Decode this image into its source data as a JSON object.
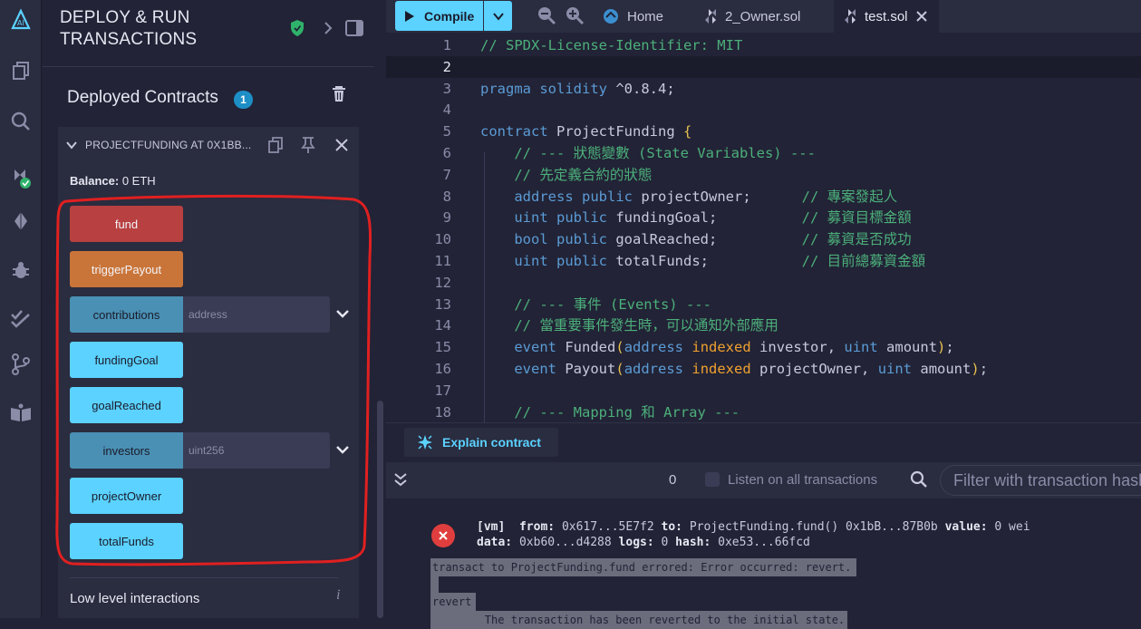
{
  "panel": {
    "title_line1": "DEPLOY & RUN",
    "title_line2": "TRANSACTIONS",
    "deployed_label": "Deployed Contracts",
    "deployed_count": "1",
    "contract_name": "PROJECTFUNDING AT 0X1BB...",
    "balance_label": "Balance:",
    "balance_value": "0 ETH",
    "functions": [
      {
        "label": "fund",
        "style": "red"
      },
      {
        "label": "triggerPayout",
        "style": "orange"
      },
      {
        "label": "contributions",
        "style": "dim",
        "placeholder": "address"
      },
      {
        "label": "fundingGoal",
        "style": "blue"
      },
      {
        "label": "goalReached",
        "style": "blue"
      },
      {
        "label": "investors",
        "style": "dim",
        "placeholder": "uint256"
      },
      {
        "label": "projectOwner",
        "style": "blue"
      },
      {
        "label": "totalFunds",
        "style": "blue"
      }
    ],
    "low_level": "Low level interactions",
    "info_glyph": "i"
  },
  "editor": {
    "compile_label": "Compile",
    "tabs": [
      {
        "label": "Home",
        "icon": "home-icon"
      },
      {
        "label": "2_Owner.sol",
        "icon": "solidity-icon"
      },
      {
        "label": "test.sol",
        "icon": "solidity-icon",
        "active": true
      }
    ],
    "lines": [
      {
        "n": "1",
        "t": "// SPDX-License-Identifier: MIT"
      },
      {
        "n": "2",
        "t": ""
      },
      {
        "n": "3",
        "t": "pragma solidity ^0.8.4;"
      },
      {
        "n": "4",
        "t": ""
      },
      {
        "n": "5",
        "t": "contract ProjectFunding {"
      },
      {
        "n": "6",
        "t": "    // --- 狀態變數 (State Variables) ---"
      },
      {
        "n": "7",
        "t": "    // 先定義合約的狀態"
      },
      {
        "n": "8",
        "t": "    address public projectOwner;      // 專案發起人"
      },
      {
        "n": "9",
        "t": "    uint public fundingGoal;          // 募資目標金額"
      },
      {
        "n": "10",
        "t": "    bool public goalReached;          // 募資是否成功"
      },
      {
        "n": "11",
        "t": "    uint public totalFunds;           // 目前總募資金額"
      },
      {
        "n": "12",
        "t": ""
      },
      {
        "n": "13",
        "t": "    // --- 事件 (Events) ---"
      },
      {
        "n": "14",
        "t": "    // 當重要事件發生時，可以通知外部應用"
      },
      {
        "n": "15",
        "t": "    event Funded(address indexed investor, uint amount);"
      },
      {
        "n": "16",
        "t": "    event Payout(address indexed projectOwner, uint amount);"
      },
      {
        "n": "17",
        "t": ""
      },
      {
        "n": "18",
        "t": "    // --- Mapping 和 Array ---"
      }
    ],
    "explain_label": "Explain contract"
  },
  "terminal": {
    "count": "0",
    "listen_label": "Listen on all transactions",
    "filter_placeholder": "Filter with transaction hash or address",
    "log_vm": "[vm]",
    "log_from_label": "from:",
    "log_from": "0x617...5E7f2",
    "log_to_label": "to:",
    "log_to": "ProjectFunding.fund() 0x1bB...87B0b",
    "log_value_label": "value:",
    "log_value": "0 wei",
    "log_data_label": "data:",
    "log_data": "0xb60...d4288",
    "log_logs_label": "logs:",
    "log_logs": "0",
    "log_hash_label": "hash:",
    "log_hash": "0xe53...66fcd",
    "err1": "transact to ProjectFunding.fund errored: Error occurred: revert.",
    "err2": "revert",
    "err3": "        The transaction has been reverted to the initial state."
  }
}
